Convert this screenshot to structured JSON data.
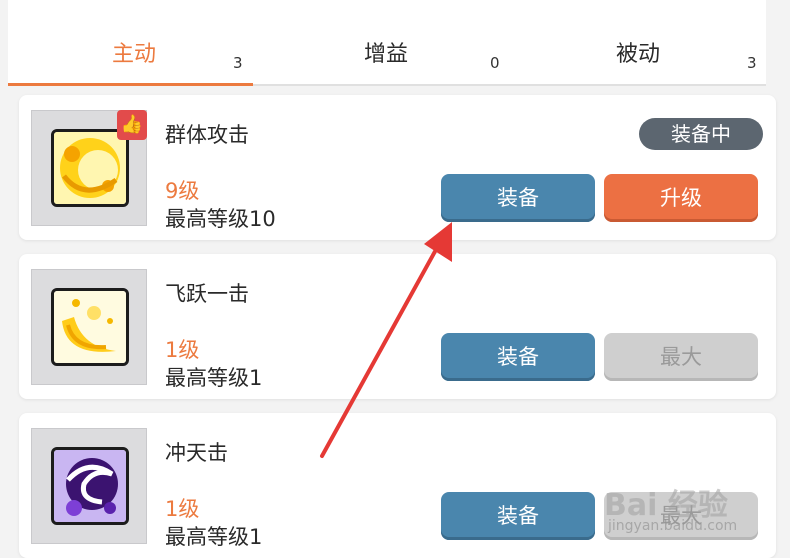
{
  "tabs": [
    {
      "label": "主动",
      "count": "3",
      "active": true
    },
    {
      "label": "增益",
      "count": "0",
      "active": false
    },
    {
      "label": "被动",
      "count": "3",
      "active": false
    }
  ],
  "skills": [
    {
      "name": "群体攻击",
      "level": "9级",
      "max_level": "最高等级10",
      "equipped_label": "装备中",
      "equip_label": "装备",
      "upgrade_label": "升级",
      "recommended_icon": "thumbs-up-icon",
      "art_icon": "golden-crescent-icon"
    },
    {
      "name": "飞跃一击",
      "level": "1级",
      "max_level": "最高等级1",
      "equip_label": "装备",
      "upgrade_label": "最大",
      "art_icon": "golden-slash-icon"
    },
    {
      "name": "冲天击",
      "level": "1级",
      "max_level": "最高等级1",
      "equip_label": "装备",
      "upgrade_label": "最大",
      "art_icon": "purple-swirl-icon"
    }
  ],
  "watermark": {
    "logo": "Bai 经验",
    "url": "jingyan.baidu.com"
  },
  "colors": {
    "accent": "#ec7a3f",
    "equip": "#4a86ad",
    "upgrade": "#ec7043",
    "annotation": "#e53935"
  }
}
